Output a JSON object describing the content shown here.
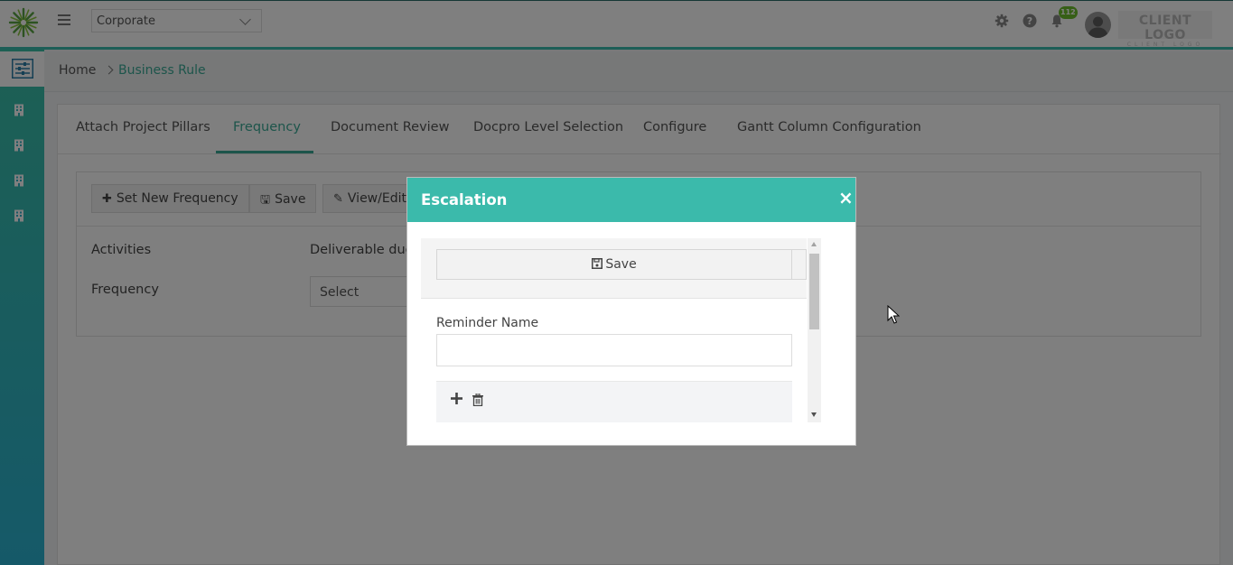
{
  "header": {
    "department_select": "Corporate",
    "notification_count": "112",
    "client_logo_text": "CLIENT LOGO",
    "client_logo_subtext": "CLIENT LOGO"
  },
  "sidebar": {
    "items": [
      {
        "icon": "sliders-icon",
        "active": true
      },
      {
        "icon": "building-icon"
      },
      {
        "icon": "building-icon"
      },
      {
        "icon": "building-icon"
      },
      {
        "icon": "building-icon"
      }
    ]
  },
  "breadcrumb": {
    "home": "Home",
    "current": "Business Rule"
  },
  "tabs": [
    {
      "label": "Attach Project Pillars"
    },
    {
      "label": "Frequency",
      "active": true
    },
    {
      "label": "Document Review"
    },
    {
      "label": "Docpro Level Selection"
    },
    {
      "label": "Configure"
    },
    {
      "label": "Gantt Column Configuration"
    }
  ],
  "panel": {
    "buttons": {
      "set_new_frequency": "Set New Frequency",
      "save": "Save",
      "view_edit": "View/Edit"
    },
    "activities_label": "Activities",
    "activities_value": "Deliverable due",
    "frequency_label": "Frequency",
    "frequency_select": "Select"
  },
  "modal": {
    "title": "Escalation",
    "close": "×",
    "save_label": "Save",
    "reminder_name_label": "Reminder Name",
    "reminder_name_value": ""
  },
  "colors": {
    "accent": "#3bbaab",
    "active_text": "#3aaa96",
    "badge": "#6cbf2d"
  }
}
